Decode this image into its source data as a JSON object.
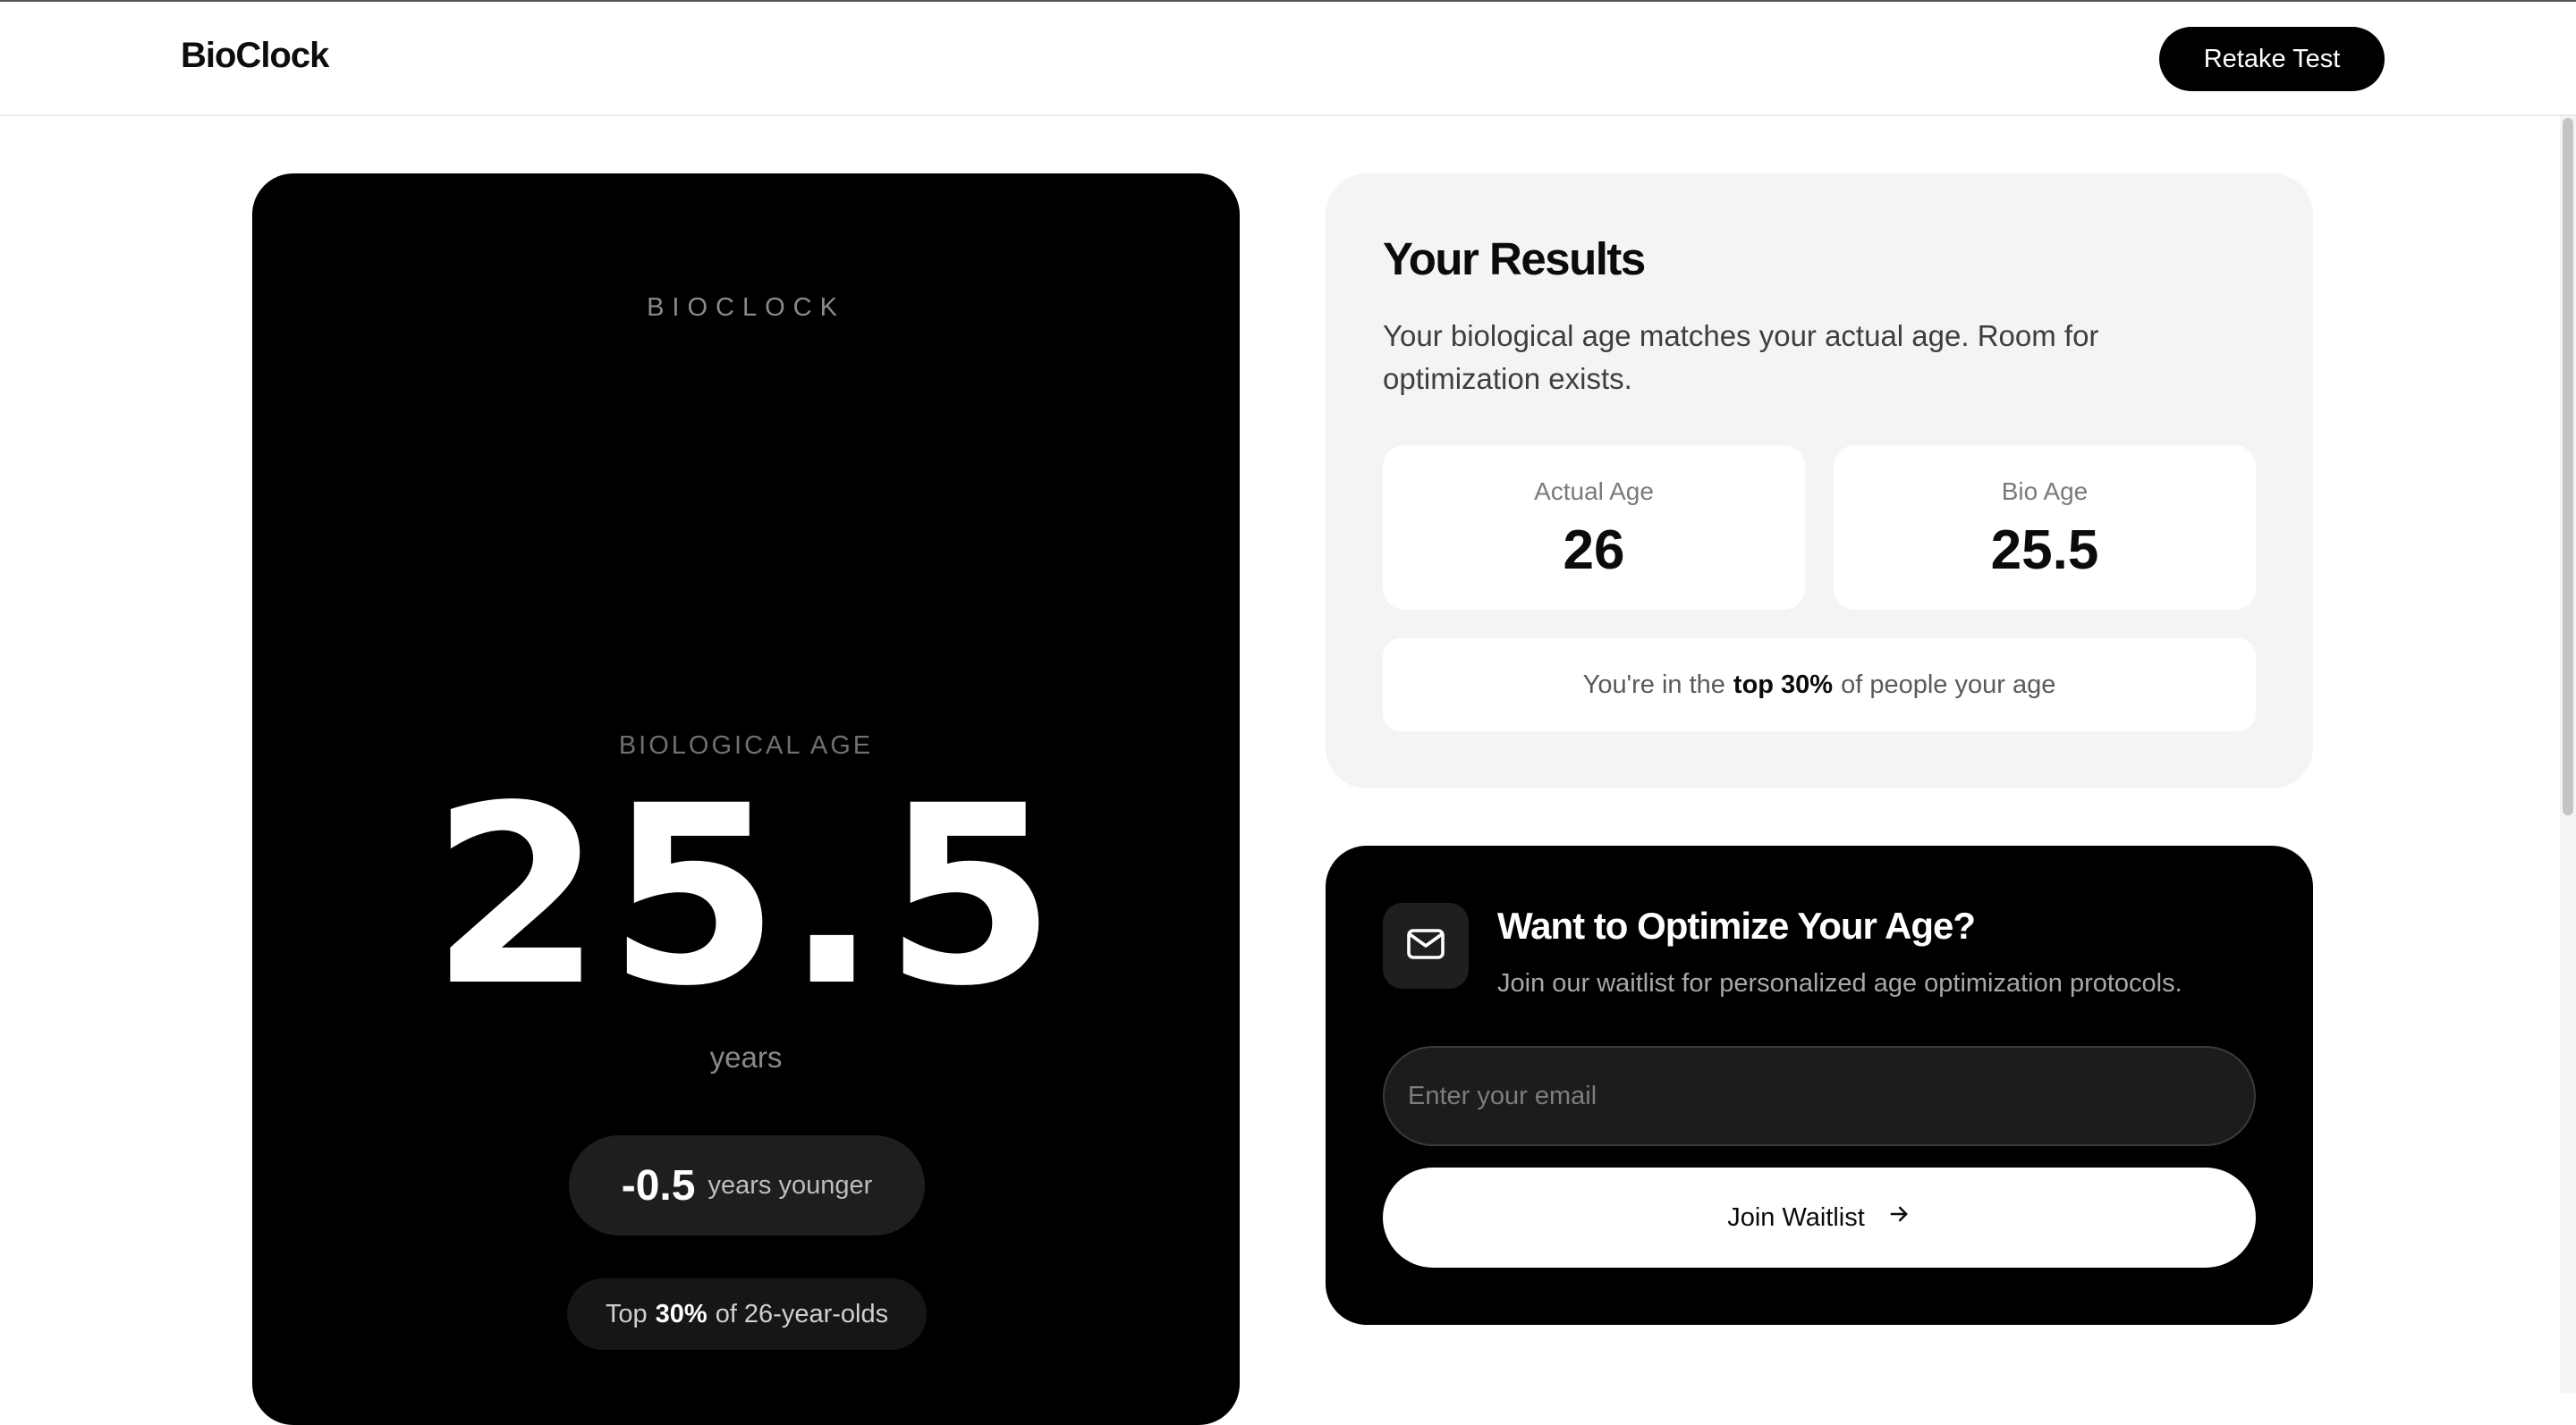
{
  "header": {
    "logo": "BioClock",
    "retake_label": "Retake Test"
  },
  "clock_card": {
    "brand": "BIOCLOCK",
    "bio_label": "BIOLOGICAL AGE",
    "bio_value": "25.5",
    "unit": "years",
    "diff_value": "-0.5",
    "diff_text": "years younger",
    "top_prefix": "Top",
    "top_value": "30%",
    "top_suffix": "of 26-year-olds"
  },
  "results": {
    "title": "Your Results",
    "description": "Your biological age matches your actual age. Room for optimization exists.",
    "actual_label": "Actual Age",
    "actual_value": "26",
    "bio_label": "Bio Age",
    "bio_value": "25.5",
    "percentile_prefix": "You're in the",
    "percentile_bold": "top 30%",
    "percentile_suffix": "of people your age"
  },
  "waitlist": {
    "icon": "mail-icon",
    "title": "Want to Optimize Your Age?",
    "subtitle": "Join our waitlist for personalized age optimization protocols.",
    "email_placeholder": "Enter your email",
    "button_label": "Join Waitlist",
    "button_icon": "arrow-right-icon"
  }
}
